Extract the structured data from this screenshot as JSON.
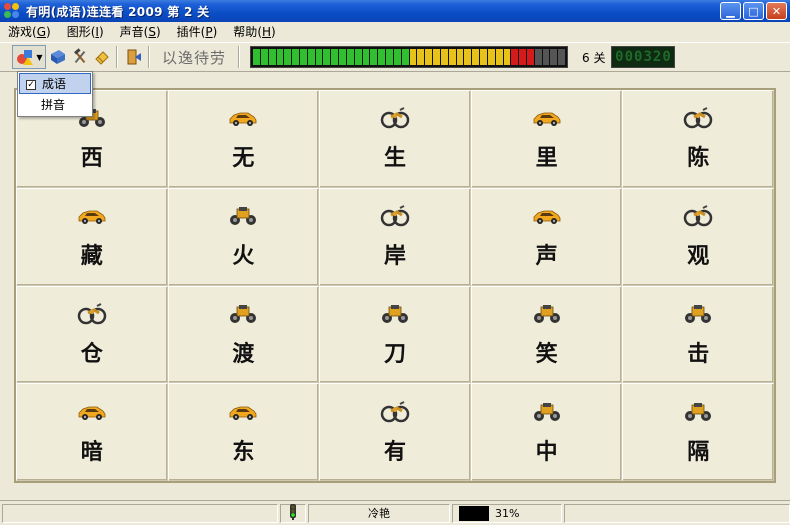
{
  "window": {
    "title": "有明(成语)连连看 2009  第 2 关"
  },
  "menu": {
    "items": [
      {
        "label": "游戏",
        "key": "G"
      },
      {
        "label": "图形",
        "key": "I"
      },
      {
        "label": "声音",
        "key": "S"
      },
      {
        "label": "插件",
        "key": "P"
      },
      {
        "label": "帮助",
        "key": "H"
      }
    ]
  },
  "toolbar": {
    "motto": "以逸待劳",
    "level_label": "6 关",
    "score": "000320",
    "timer_fraction": 0.9
  },
  "dropdown": {
    "items": [
      {
        "label": "成语",
        "checked": true
      },
      {
        "label": "拼音",
        "checked": false
      }
    ]
  },
  "board": {
    "tiles": [
      {
        "char": "西",
        "icon": "truck-icon"
      },
      {
        "char": "无",
        "icon": "car-icon"
      },
      {
        "char": "生",
        "icon": "motorbike-icon"
      },
      {
        "char": "里",
        "icon": "car-icon"
      },
      {
        "char": "陈",
        "icon": "motorbike-icon"
      },
      {
        "char": "藏",
        "icon": "car-icon"
      },
      {
        "char": "火",
        "icon": "truck-icon"
      },
      {
        "char": "岸",
        "icon": "motorbike-icon"
      },
      {
        "char": "声",
        "icon": "car-icon"
      },
      {
        "char": "观",
        "icon": "motorbike-icon"
      },
      {
        "char": "仓",
        "icon": "motorbike-icon"
      },
      {
        "char": "渡",
        "icon": "truck-icon"
      },
      {
        "char": "刀",
        "icon": "truck-icon"
      },
      {
        "char": "笑",
        "icon": "truck-icon"
      },
      {
        "char": "击",
        "icon": "truck-icon"
      },
      {
        "char": "暗",
        "icon": "car-icon"
      },
      {
        "char": "东",
        "icon": "car-icon"
      },
      {
        "char": "有",
        "icon": "motorbike-icon"
      },
      {
        "char": "中",
        "icon": "truck-icon"
      },
      {
        "char": "隔",
        "icon": "truck-icon"
      }
    ]
  },
  "status": {
    "word": "冷艳",
    "percent": "31%"
  }
}
